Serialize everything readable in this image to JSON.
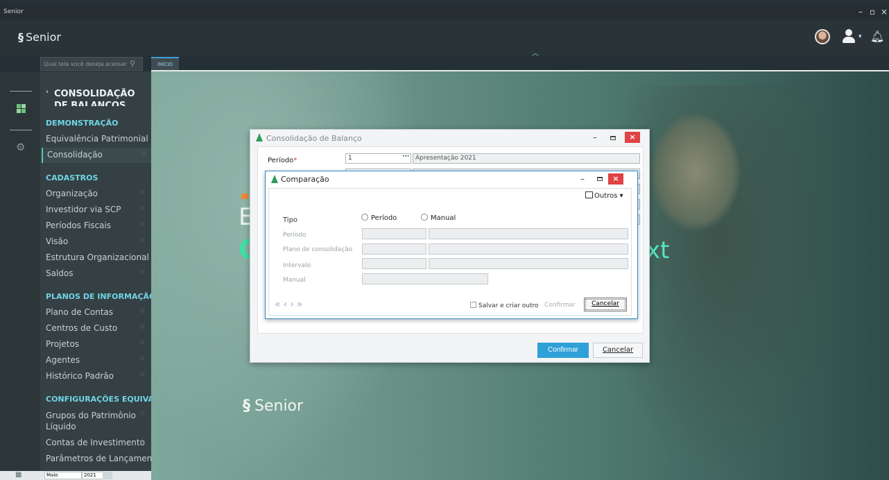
{
  "window": {
    "title": "Senior"
  },
  "header": {
    "brand": "Senior"
  },
  "search": {
    "placeholder": "Qual tela você deseja acessar?"
  },
  "tabs": [
    {
      "label": "INÍCIO"
    }
  ],
  "nav": {
    "module_title": "CONSOLIDAÇÃO DE BALANÇOS",
    "sections": [
      {
        "title": "DEMONSTRAÇÃO",
        "items": [
          "Equivalência Patrimonial",
          "Consolidação"
        ]
      },
      {
        "title": "CADASTROS",
        "items": [
          "Organização",
          "Investidor via SCP",
          "Períodos Fiscais",
          "Visão",
          "Estrutura Organizacional",
          "Saldos"
        ]
      },
      {
        "title": "PLANOS DE INFORMAÇÃO",
        "items": [
          "Plano de Contas",
          "Centros de Custo",
          "Projetos",
          "Agentes",
          "Histórico Padrão"
        ]
      },
      {
        "title": "CONFIGURAÇÕES EQUIVALÊNCIA",
        "items": [
          "Grupos do Patrimônio Líquido",
          "Contas de Investimento",
          "Parâmetros de Lançamentos"
        ]
      }
    ],
    "selected": "Consolidação"
  },
  "statusbar": {
    "month": "Maio",
    "year": "2021"
  },
  "hero": {
    "line1": "E",
    "line2": "C",
    "line3": "xt",
    "logo": "Senior"
  },
  "dialog_consolidacao": {
    "title": "Consolidação de Balanço",
    "periodo_label": "Período",
    "periodo_value": "1",
    "periodo_desc": "Apresentação 2021",
    "confirm_label": "Confirmar",
    "cancel_label": "Cancelar"
  },
  "dialog_comparacao": {
    "title": "Comparação",
    "outros_label": "Outros",
    "tipo_label": "Tipo",
    "radio_periodo": "Período",
    "radio_manual": "Manual",
    "periodo_label": "Período",
    "plano_label": "Plano de consolidação",
    "intervalo_label": "Intervalo",
    "manual_label": "Manual",
    "salvar_label": "Salvar e criar outro",
    "confirm_label": "Confirmar",
    "cancel_label": "Cancelar"
  },
  "colors": {
    "accent": "#2fa0d8",
    "section": "#71d5e6",
    "close": "#e04343",
    "brand_green": "#2e9d59"
  }
}
